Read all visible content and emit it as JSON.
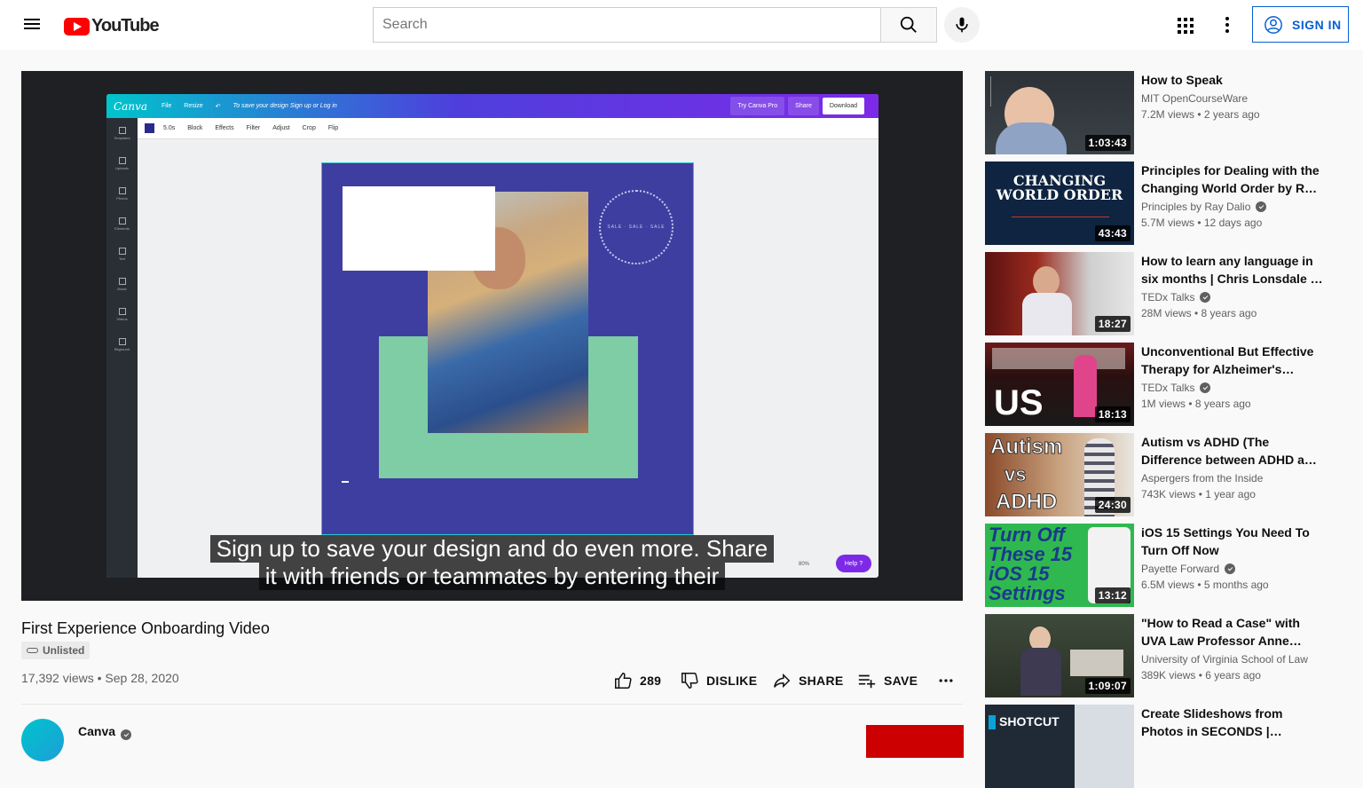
{
  "header": {
    "logo_text": "YouTube",
    "search_placeholder": "Search",
    "signin_label": "SIGN IN"
  },
  "player": {
    "canva": {
      "logo": "Canva",
      "menu": [
        "File",
        "Resize"
      ],
      "save_prompt": "To save your design Sign up or Log in",
      "try_pro": "Try Canva Pro",
      "share": "Share",
      "download": "Download",
      "toolbar": [
        "5.0s",
        "Block",
        "Effects",
        "Filter",
        "Adjust",
        "Crop",
        "Flip"
      ],
      "sidebar": [
        "Templates",
        "Uploads",
        "Photos",
        "Elements",
        "Text",
        "Music",
        "Videos",
        "Bkground"
      ],
      "sale_text": "SALE · SALE · SALE",
      "zoom": "80%",
      "help": "Help ?"
    },
    "captions": [
      "Sign up to save your design and do even more. Share",
      "it with friends or teammates by entering their"
    ]
  },
  "video": {
    "title": "First Experience Onboarding Video",
    "visibility": "Unlisted",
    "meta": "17,392 views • Sep 28, 2020",
    "likes": "289",
    "dislike_label": "DISLIKE",
    "share_label": "SHARE",
    "save_label": "SAVE",
    "channel": "Canva"
  },
  "recommendations": [
    {
      "title": "How to Speak",
      "channel": "MIT OpenCourseWare",
      "verified": false,
      "views": "7.2M views • 2 years ago",
      "duration": "1:03:43"
    },
    {
      "title": "Principles for Dealing with the Changing World Order by Ray Dalio",
      "channel": "Principles by Ray Dalio",
      "verified": true,
      "views": "5.7M views • 12 days ago",
      "duration": "43:43",
      "thumb_text": [
        "CHANGING",
        "WORLD ORDER"
      ]
    },
    {
      "title": "How to learn any language in six months | Chris Lonsdale | TEDxLingnanUniversity",
      "channel": "TEDx Talks",
      "verified": true,
      "views": "28M views • 8 years ago",
      "duration": "18:27"
    },
    {
      "title": "Unconventional But Effective Therapy for Alzheimer's Dementia",
      "channel": "TEDx Talks",
      "verified": true,
      "views": "1M views • 8 years ago",
      "duration": "18:13",
      "thumb_text": [
        "US"
      ]
    },
    {
      "title": "Autism vs ADHD (The Difference between ADHD and Autism)",
      "channel": "Aspergers from the Inside",
      "verified": false,
      "views": "743K views • 1 year ago",
      "duration": "24:30",
      "thumb_text": [
        "Autism",
        "vs",
        "ADHD"
      ]
    },
    {
      "title": "iOS 15 Settings You Need To Turn Off Now",
      "channel": "Payette Forward",
      "verified": true,
      "views": "6.5M views • 5 months ago",
      "duration": "13:12",
      "thumb_text": [
        "Turn Off",
        "These 15",
        "iOS 15",
        "Settings"
      ]
    },
    {
      "title": "\"How to Read a Case\" with UVA Law Professor Anne Coughlin",
      "channel": "University of Virginia School of Law",
      "verified": false,
      "views": "389K views • 6 years ago",
      "duration": "1:09:07"
    },
    {
      "title": "Create Slideshows from Photos in SECONDS | Quickest, Easiest",
      "channel": "",
      "verified": false,
      "views": "",
      "duration": "",
      "thumb_text": [
        "SHOTCUT"
      ]
    }
  ],
  "colors": {
    "brand_red": "#ff0000",
    "link_blue": "#065fd4",
    "canva_purple": "#3e3ea0",
    "canva_green": "#7ecda5"
  },
  "icons": [
    "menu-icon",
    "youtube-logo-icon",
    "search-icon",
    "mic-icon",
    "apps-icon",
    "more-vert-icon",
    "account-circle-icon",
    "like-icon",
    "dislike-icon",
    "share-icon",
    "playlist-add-icon",
    "more-horiz-icon",
    "verified-icon"
  ]
}
